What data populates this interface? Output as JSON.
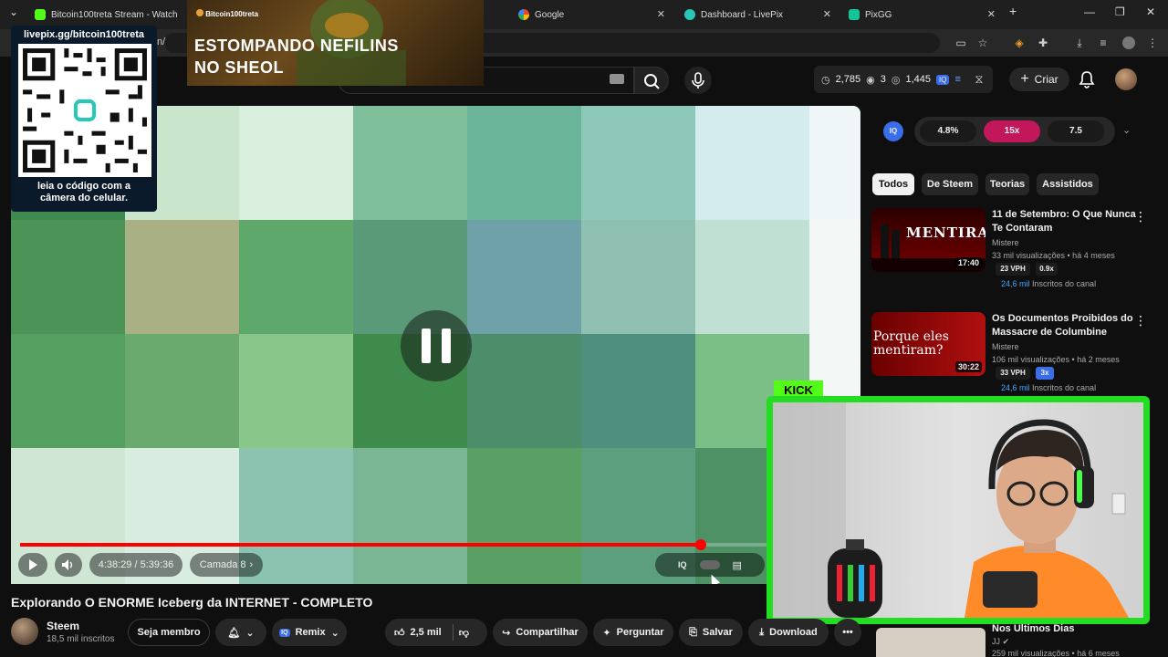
{
  "browser": {
    "tabs": [
      {
        "title": "Bitcoin100treta Stream - Watch",
        "icon": "kick-favicon"
      },
      {
        "title": "Bitcoin100treta",
        "icon": "livepix-favicon"
      },
      {
        "title": "Google",
        "icon": "google-favicon"
      },
      {
        "title": "Dashboard - LivePix",
        "icon": "livepix-favicon"
      },
      {
        "title": "PixGG",
        "icon": "pixgg-favicon"
      }
    ],
    "address_fragment": "n/"
  },
  "youtube": {
    "stats": {
      "views": "2,785",
      "likes": "3",
      "watching": "1,445"
    },
    "create_label": "Criar"
  },
  "overlay": {
    "qr_url": "livepix.gg/bitcoin100treta",
    "qr_caption_line1": "leia o código com a",
    "qr_caption_line2": "câmera do celular.",
    "banner_tag": "Bitcoin100treta",
    "banner_title_line1": "ESTOMPANDO NEFILINS",
    "banner_title_line2": "NO SHEOL",
    "kick_label": "KICK"
  },
  "player": {
    "time": "4:38:29 / 5:39:36",
    "chapter": "Camada 8",
    "progress": 0.82
  },
  "iq_bar": {
    "logo": "IQ",
    "values": [
      "4.8%",
      "15x",
      "7.5"
    ]
  },
  "chips": [
    "Todos",
    "De Steem",
    "Teorias",
    "Assistidos"
  ],
  "recommendations": [
    {
      "title": "11 de Setembro: O Que Nunca Te Contaram",
      "channel": "Mistere",
      "meta": "33 mil visualizações • há 4 meses",
      "duration": "17:40",
      "vph": "23 VPH",
      "ratio": "0.9x",
      "subs_value": "24,6 mil",
      "subs_label": "Inscritos do canal",
      "thumb_text": "MENTIRA"
    },
    {
      "title": "Os Documentos Proibidos do Massacre de Columbine",
      "channel": "Mistere",
      "meta": "106 mil visualizações • há 2 meses",
      "duration": "30:22",
      "vph": "33 VPH",
      "ratio": "3x",
      "subs_value": "24,6 mil",
      "subs_label": "Inscritos do canal",
      "thumb_text_line1": "Porque eles",
      "thumb_text_line2": "mentiram?"
    }
  ],
  "partial_rec": {
    "title": "Nos Últimos Dias",
    "channel": "JJ",
    "meta": "259 mil visualizações • há 6 meses"
  },
  "video": {
    "title": "Explorando O ENORME Iceberg da INTERNET - COMPLETO",
    "channel": "Steem",
    "subscribers": "18,5 mil inscritos",
    "join_label": "Seja membro",
    "remix_label": "Remix",
    "likes": "2,5 mil",
    "share_label": "Compartilhar",
    "ask_label": "Perguntar",
    "save_label": "Salvar",
    "download_label": "Download"
  }
}
